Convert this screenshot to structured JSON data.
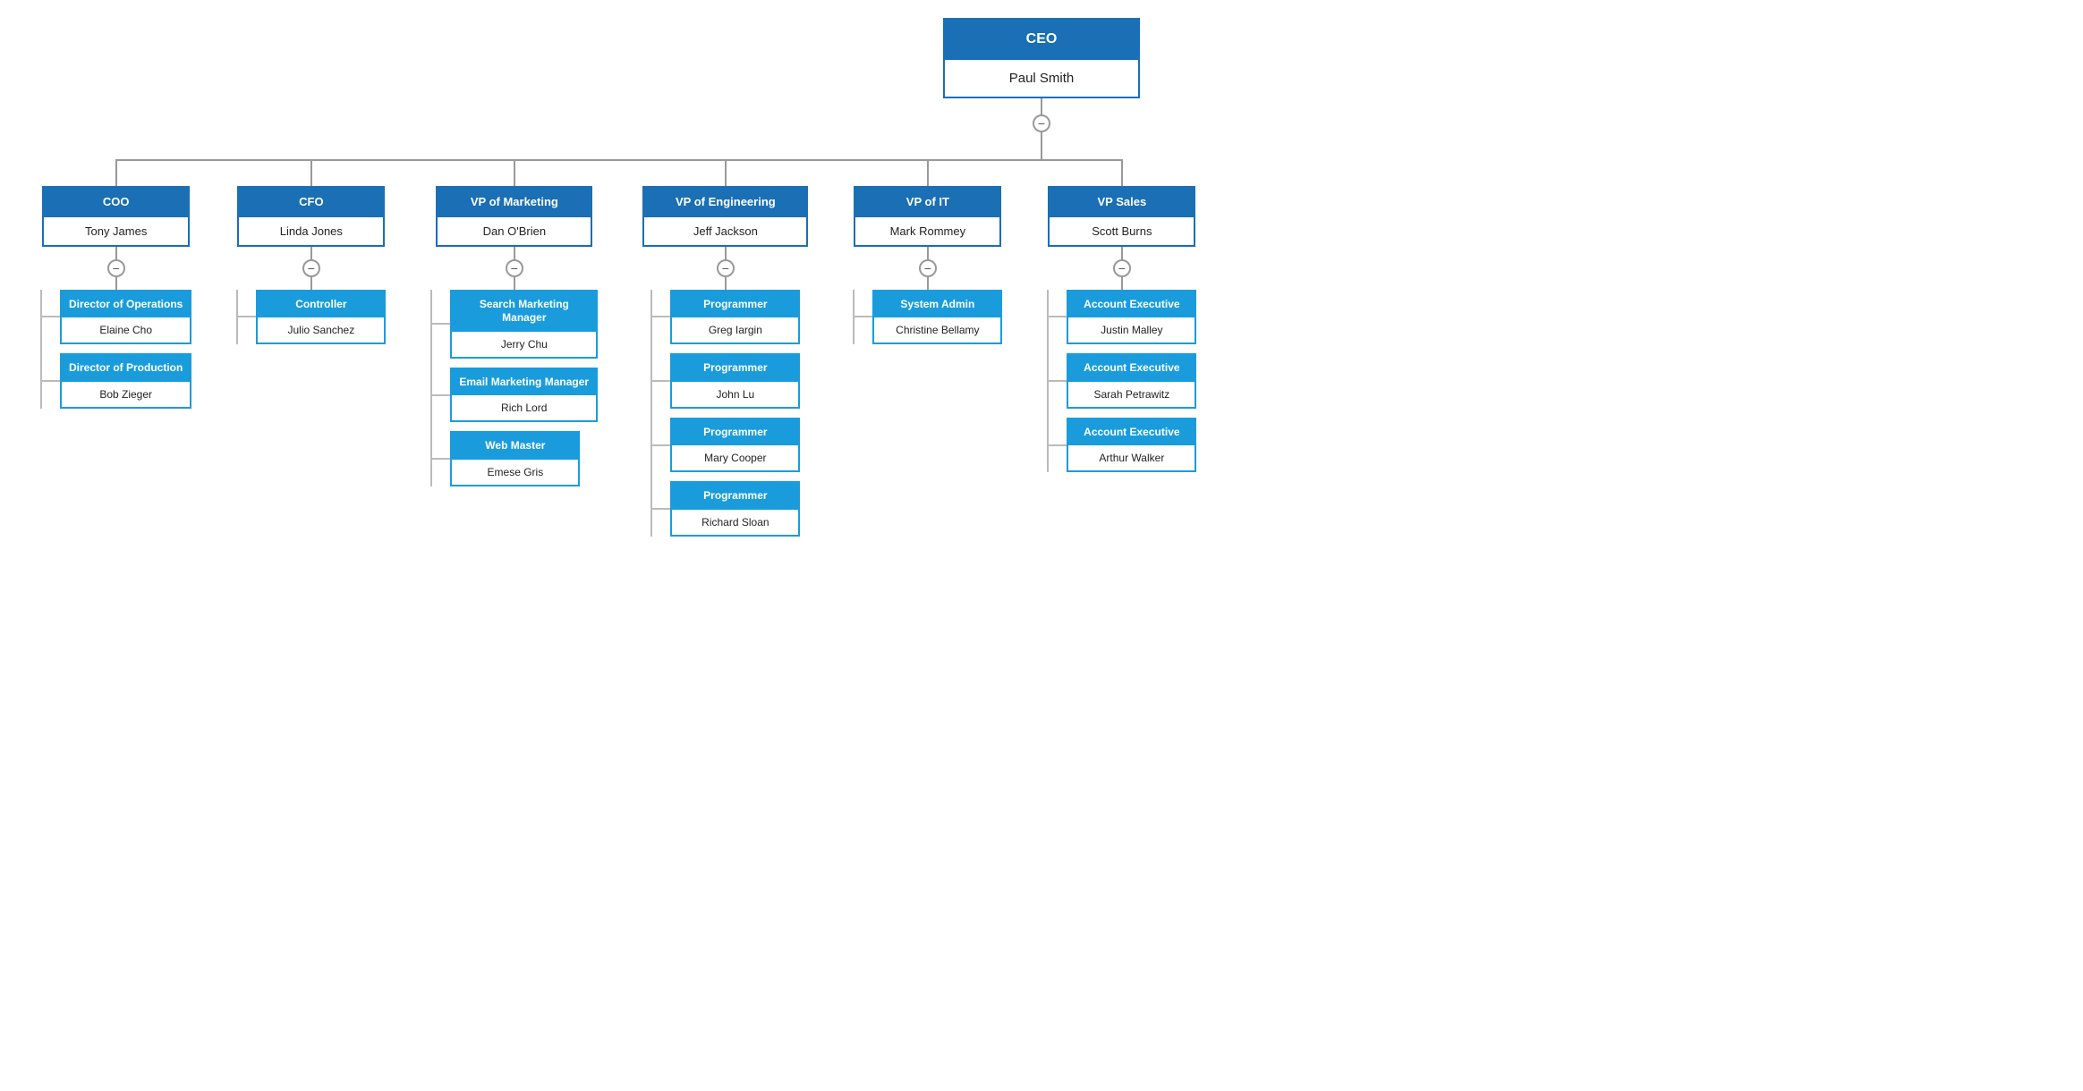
{
  "ceo": {
    "title": "CEO",
    "name": "Paul Smith"
  },
  "l2": [
    {
      "id": "coo",
      "title": "COO",
      "name": "Tony James",
      "children": [
        {
          "title": "Director of Operations",
          "name": "Elaine Cho"
        },
        {
          "title": "Director of Production",
          "name": "Bob Zieger"
        }
      ]
    },
    {
      "id": "cfo",
      "title": "CFO",
      "name": "Linda Jones",
      "children": [
        {
          "title": "Controller",
          "name": "Julio Sanchez"
        }
      ]
    },
    {
      "id": "vp-marketing",
      "title": "VP of Marketing",
      "name": "Dan O'Brien",
      "children": [
        {
          "title": "Search Marketing Manager",
          "name": "Jerry Chu"
        },
        {
          "title": "Email Marketing Manager",
          "name": "Rich Lord"
        },
        {
          "title": "Web Master",
          "name": "Emese Gris"
        }
      ]
    },
    {
      "id": "vp-engineering",
      "title": "VP of Engineering",
      "name": "Jeff Jackson",
      "children": [
        {
          "title": "Programmer",
          "name": "Greg Iargin"
        },
        {
          "title": "Programmer",
          "name": "John Lu"
        },
        {
          "title": "Programmer",
          "name": "Mary Cooper"
        },
        {
          "title": "Programmer",
          "name": "Richard Sloan"
        }
      ]
    },
    {
      "id": "vp-it",
      "title": "VP of IT",
      "name": "Mark Rommey",
      "children": [
        {
          "title": "System Admin",
          "name": "Christine Bellamy"
        }
      ]
    },
    {
      "id": "vp-sales",
      "title": "VP Sales",
      "name": "Scott Burns",
      "children": [
        {
          "title": "Account Executive",
          "name": "Justin Malley"
        },
        {
          "title": "Account Executive",
          "name": "Sarah Petrawitz"
        },
        {
          "title": "Account Executive",
          "name": "Arthur Walker"
        }
      ]
    }
  ],
  "ui": {
    "collapse_symbol": "−"
  }
}
